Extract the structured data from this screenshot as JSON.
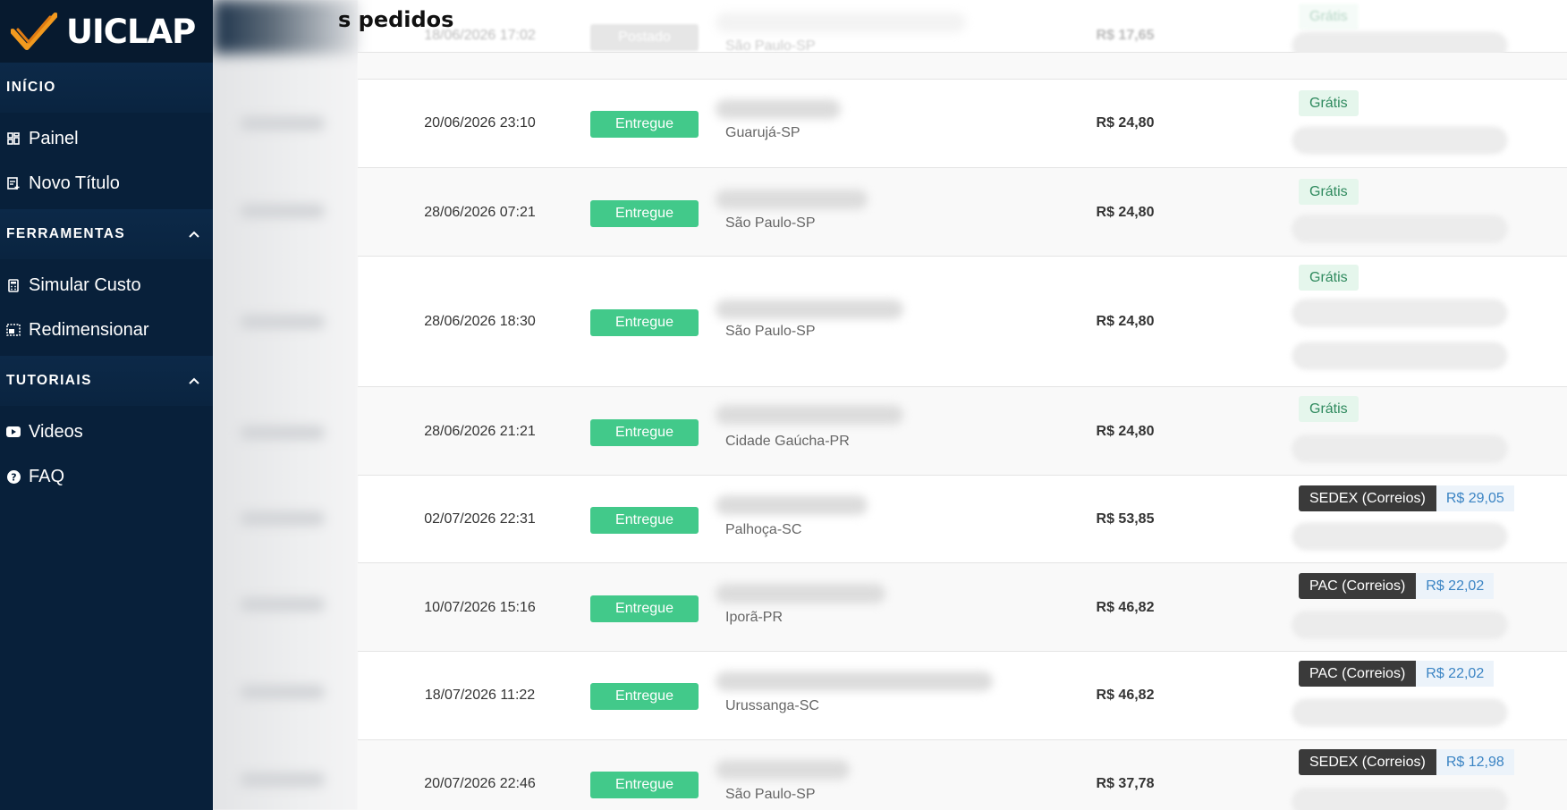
{
  "brand": {
    "name": "UICLAP"
  },
  "sidebar": {
    "sections": [
      {
        "title": "INÍCIO",
        "items": [
          {
            "label": "Painel",
            "icon": "dashboard-icon"
          },
          {
            "label": "Novo Título",
            "icon": "new-title-icon"
          }
        ]
      },
      {
        "title": "FERRAMENTAS",
        "items": [
          {
            "label": "Simular Custo",
            "icon": "calculator-icon"
          },
          {
            "label": "Redimensionar",
            "icon": "resize-icon"
          }
        ]
      },
      {
        "title": "TUTORIAIS",
        "items": [
          {
            "label": "Videos",
            "icon": "youtube-icon"
          },
          {
            "label": "FAQ",
            "icon": "help-icon"
          }
        ]
      }
    ]
  },
  "page": {
    "title": "s pedidos"
  },
  "orders": [
    {
      "date": "18/06/2026 17:02",
      "status": "Postado",
      "city": "São Paulo-SP",
      "total": "R$ 17,65",
      "shipping": {
        "type": "free",
        "label": "Grátis"
      }
    },
    {
      "date": "20/06/2026 23:10",
      "status": "Entregue",
      "city": "Guarujá-SP",
      "total": "R$ 24,80",
      "shipping": {
        "type": "free",
        "label": "Grátis"
      }
    },
    {
      "date": "28/06/2026 07:21",
      "status": "Entregue",
      "city": "São Paulo-SP",
      "total": "R$ 24,80",
      "shipping": {
        "type": "free",
        "label": "Grátis"
      }
    },
    {
      "date": "28/06/2026 18:30",
      "status": "Entregue",
      "city": "São Paulo-SP",
      "total": "R$ 24,80",
      "shipping": {
        "type": "free",
        "label": "Grátis"
      }
    },
    {
      "date": "28/06/2026 21:21",
      "status": "Entregue",
      "city": "Cidade Gaúcha-PR",
      "total": "R$ 24,80",
      "shipping": {
        "type": "free",
        "label": "Grátis"
      }
    },
    {
      "date": "02/07/2026 22:31",
      "status": "Entregue",
      "city": "Palhoça-SC",
      "total": "R$ 53,85",
      "shipping": {
        "type": "paid",
        "label": "SEDEX (Correios)",
        "price": "R$ 29,05"
      }
    },
    {
      "date": "10/07/2026 15:16",
      "status": "Entregue",
      "city": "Iporã-PR",
      "total": "R$ 46,82",
      "shipping": {
        "type": "paid",
        "label": "PAC (Correios)",
        "price": "R$ 22,02"
      }
    },
    {
      "date": "18/07/2026 11:22",
      "status": "Entregue",
      "city": "Urussanga-SC",
      "total": "R$ 46,82",
      "shipping": {
        "type": "paid",
        "label": "PAC (Correios)",
        "price": "R$ 22,02"
      }
    },
    {
      "date": "20/07/2026 22:46",
      "status": "Entregue",
      "city": "São Paulo-SP",
      "total": "R$ 37,78",
      "shipping": {
        "type": "paid",
        "label": "SEDEX (Correios)",
        "price": "R$ 12,98"
      }
    }
  ],
  "colors": {
    "sidebar": "#08203a",
    "status_delivered": "#42c98a",
    "status_posted": "#b8b8b8",
    "free_shipping_bg": "#e5f6ec",
    "carrier_bg": "#3a3a3a",
    "price_text": "#3b84c4"
  }
}
